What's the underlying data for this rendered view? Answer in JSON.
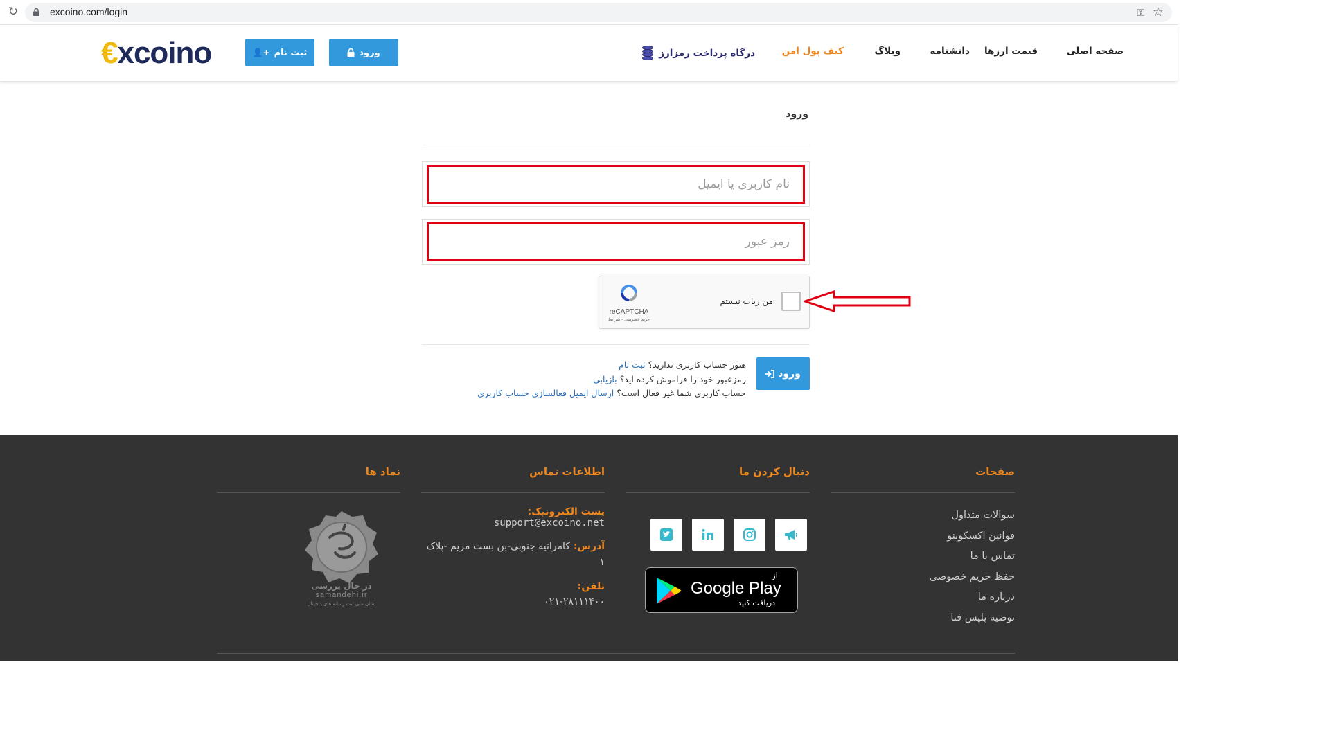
{
  "browser": {
    "url": "excoino.com/login"
  },
  "header": {
    "logo_prefix": "€",
    "logo_text": "xcoin",
    "logo_suffix": "o",
    "register_label": "ثبت نام",
    "login_label": "ورود",
    "nav": {
      "home": "صفحه اصلی",
      "prices": "قیمت ارزها",
      "wiki": "دانشنامه",
      "blog": "وبلاگ",
      "wallet": "کیف پول امن",
      "gateway": "درگاه پرداخت رمزارز"
    },
    "wallet_color": "#f0871e",
    "button_color": "#3399dd"
  },
  "login": {
    "title": "ورود",
    "username_placeholder": "نام کاربری یا ایمیل",
    "password_placeholder": "رمز عبور",
    "captcha_label": "من ربات نیستم",
    "captcha_brand": "reCAPTCHA",
    "captcha_terms": "حریم خصوصی - شرایط",
    "submit_label": "ورود",
    "help": {
      "no_account": "هنوز حساب کاربری ندارید؟",
      "register_link": "ثبت نام",
      "forgot": "رمزعبور خود را فراموش کرده اید؟",
      "recover_link": "بازیابی",
      "inactive": "حساب کاربری شما غیر فعال است؟",
      "activation_link": "ارسال ایمیل فعالسازی حساب کاربری"
    },
    "annotation_color": "#e00012"
  },
  "footer": {
    "pages_title": "صفحات",
    "pages": [
      "سوالات متداول",
      "قوانین اکسکوینو",
      "تماس با ما",
      "حفظ حریم خصوصی",
      "درباره ما",
      "توصیه پلیس فتا"
    ],
    "follow_title": "دنبال کردن ما",
    "socials": [
      "megaphone-icon",
      "instagram-icon",
      "linkedin-icon",
      "twitter-icon"
    ],
    "gplay_from": "از",
    "gplay_name": "Google Play",
    "gplay_sub": "دریافت کنید",
    "contact_title": "اطلاعات تماس",
    "email_label": "پست الکترونیک:",
    "email": "support@excoino.net",
    "address_label": "آدرس:",
    "address": "کامرانیه جنوبی-بن بست مریم -پلاک ۱",
    "phone_label": "تلفن:",
    "phone": "۰۲۱-۲۸۱۱۱۴۰۰",
    "symbols_title": "نماد ها",
    "seal_status": "در حال بررسی",
    "seal_site": "samandehi.ir",
    "seal_caption": "نشان ملی ثبت رسانه های دیجیتال",
    "accent": "#f0871e",
    "background": "#333333"
  }
}
